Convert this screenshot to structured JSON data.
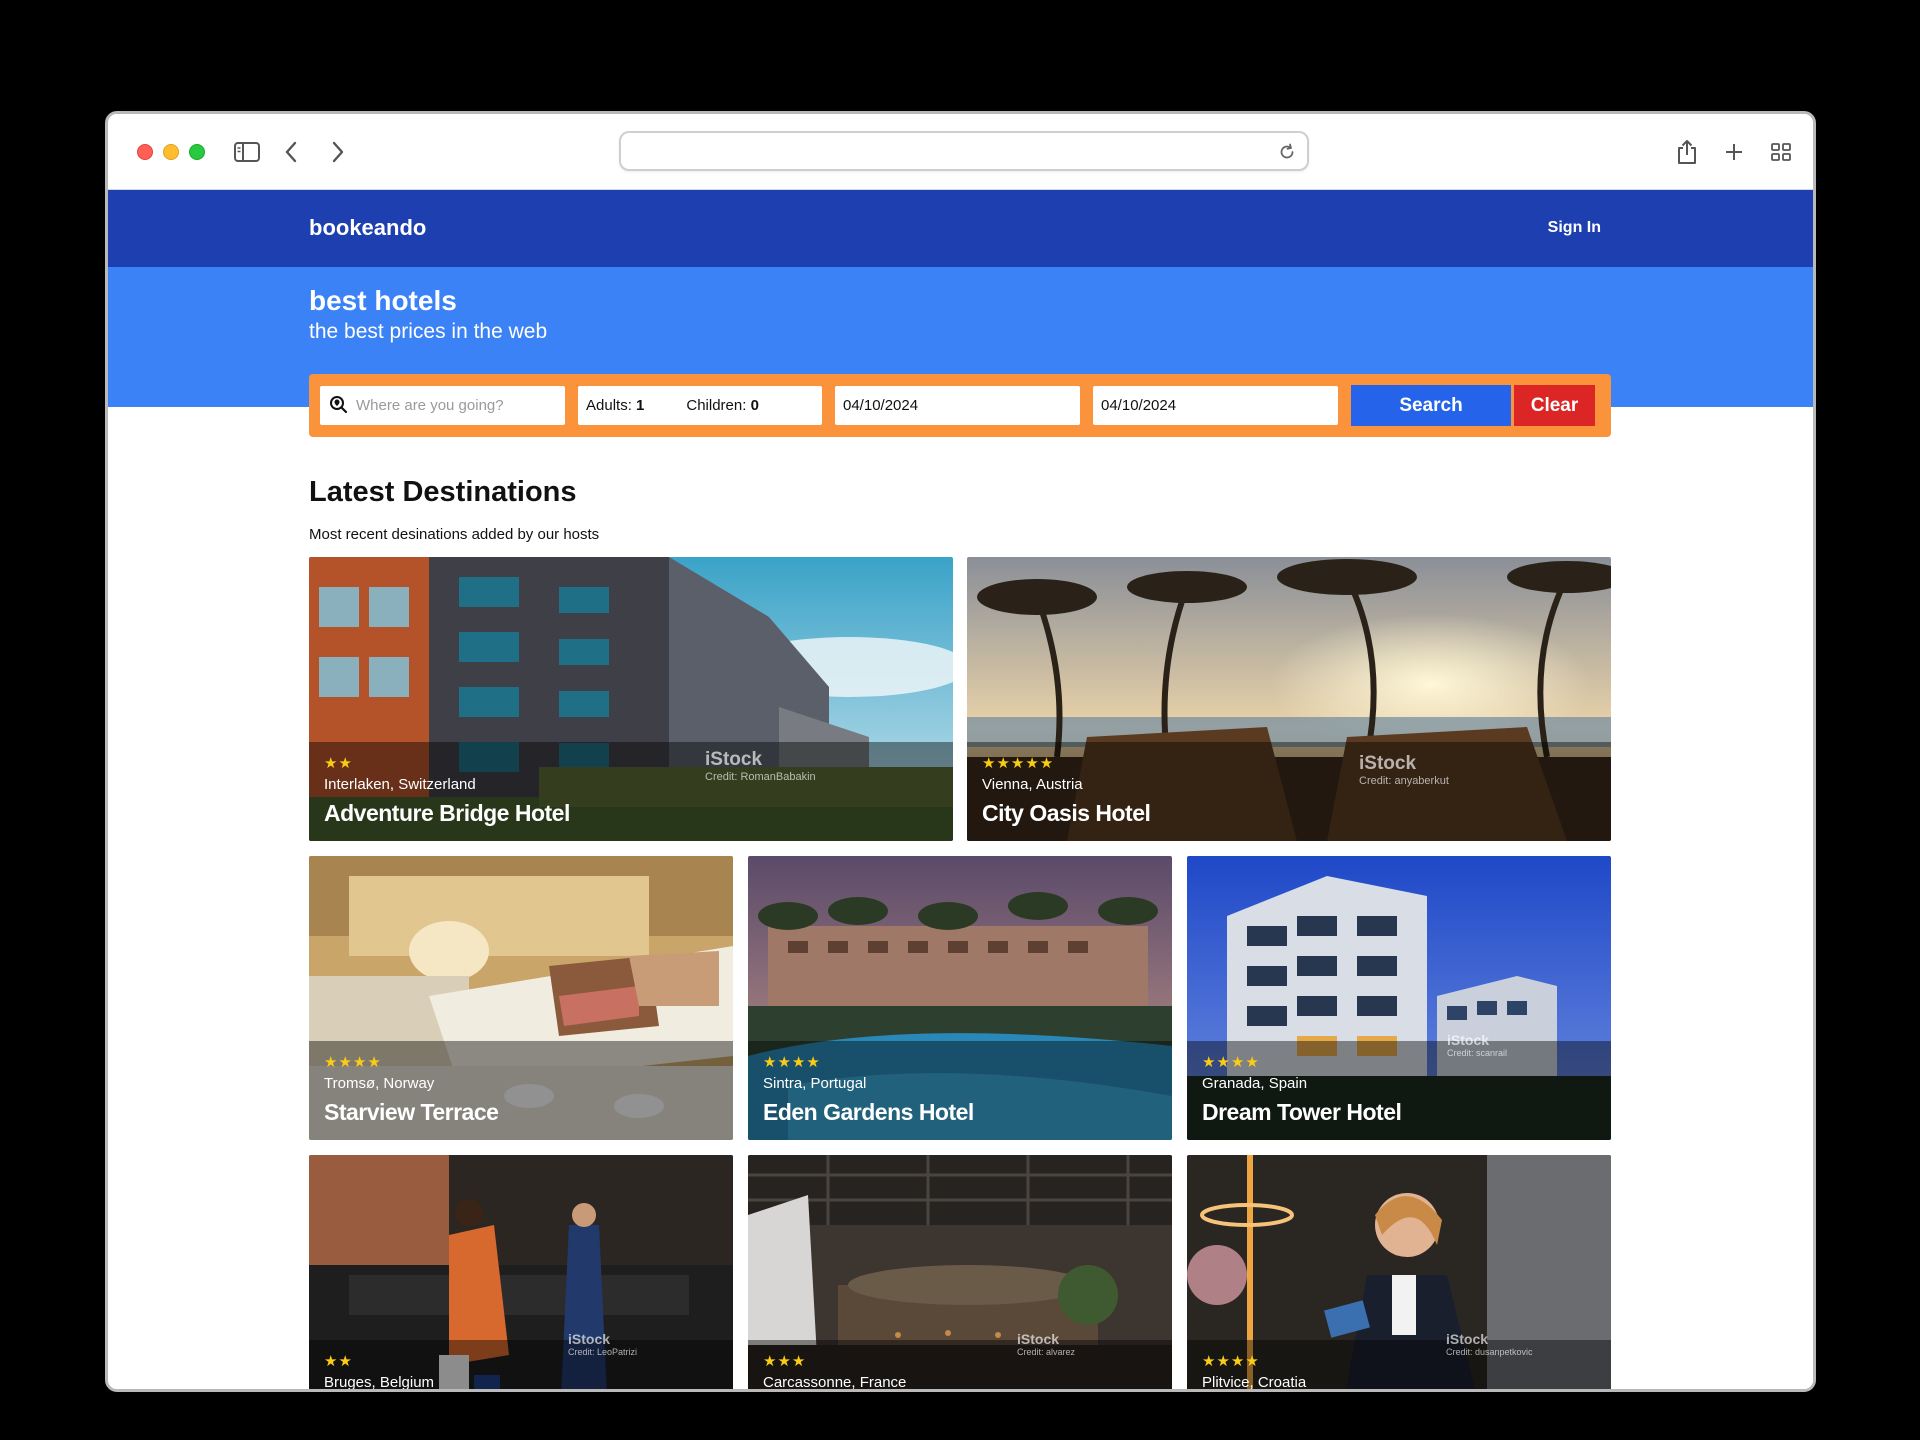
{
  "browser": {
    "url": "",
    "icons": [
      "sidebar-icon",
      "back-icon",
      "forward-icon",
      "reload-icon",
      "share-icon",
      "new-tab-icon",
      "tab-overview-icon"
    ]
  },
  "header": {
    "logo": "bookeando",
    "signin": "Sign In"
  },
  "hero": {
    "title": "best hotels",
    "subtitle": "the best prices in the web"
  },
  "search": {
    "destination_placeholder": "Where are you going?",
    "adults_label": "Adults:",
    "adults_value": "1",
    "children_label": "Children:",
    "children_value": "0",
    "checkin": "04/10/2024",
    "checkout": "04/10/2024",
    "search_label": "Search",
    "clear_label": "Clear"
  },
  "section": {
    "title": "Latest Destinations",
    "subtitle": "Most recent desinations added by our hosts"
  },
  "cards": [
    {
      "stars": "★★",
      "location": "Interlaken, Switzerland",
      "name": "Adventure Bridge Hotel",
      "watermark": "iStock",
      "credit": "Credit: RomanBabakin"
    },
    {
      "stars": "★★★★★",
      "location": "Vienna, Austria",
      "name": "City Oasis Hotel",
      "watermark": "iStock",
      "credit": "Credit: anyaberkut"
    },
    {
      "stars": "★★★★",
      "location": "Tromsø, Norway",
      "name": "Starview Terrace",
      "watermark": "",
      "credit": ""
    },
    {
      "stars": "★★★★",
      "location": "Sintra, Portugal",
      "name": "Eden Gardens Hotel",
      "watermark": "",
      "credit": ""
    },
    {
      "stars": "★★★★",
      "location": "Granada, Spain",
      "name": "Dream Tower Hotel",
      "watermark": "iStock",
      "credit": "Credit: scanrail"
    },
    {
      "stars": "★★",
      "location": "Bruges, Belgium",
      "name": "",
      "watermark": "iStock",
      "credit": "Credit: LeoPatrizi"
    },
    {
      "stars": "★★★",
      "location": "Carcassonne, France",
      "name": "",
      "watermark": "iStock",
      "credit": "Credit: alvarez"
    },
    {
      "stars": "★★★★",
      "location": "Plitvice, Croatia",
      "name": "",
      "watermark": "iStock",
      "credit": "Credit: dusanpetkovic"
    }
  ]
}
